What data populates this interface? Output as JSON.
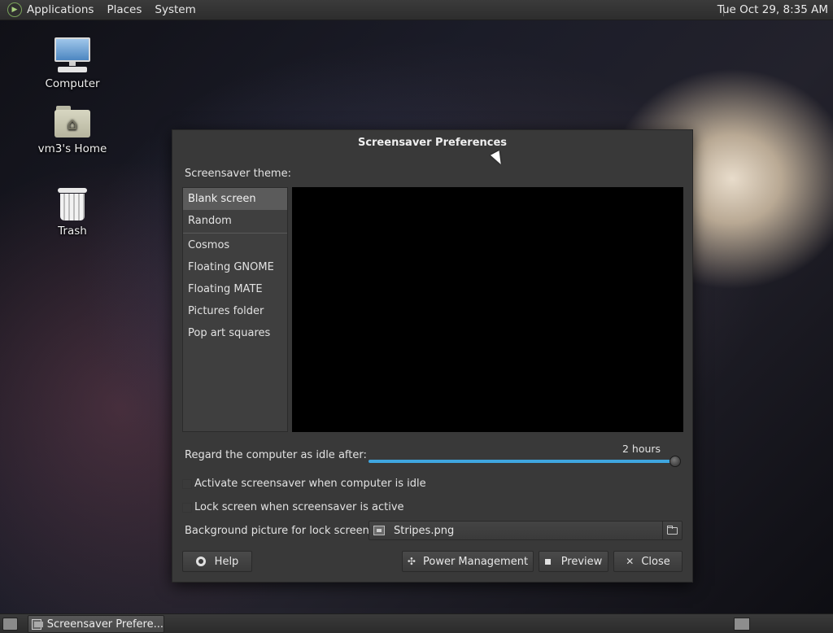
{
  "top_panel": {
    "menus": [
      "Applications",
      "Places",
      "System"
    ],
    "clock": "Tue Oct 29,  8:35 AM"
  },
  "desktop_icons": [
    {
      "label": "Computer",
      "icon": "computer-icon"
    },
    {
      "label": "vm3's Home",
      "icon": "home-folder-icon"
    },
    {
      "label": "Trash",
      "icon": "trash-icon"
    }
  ],
  "dialog": {
    "title": "Screensaver Preferences",
    "theme_label": "Screensaver theme:",
    "themes_top": [
      "Blank screen",
      "Random"
    ],
    "themes": [
      "Cosmos",
      "Floating GNOME",
      "Floating MATE",
      "Pictures folder",
      "Pop art squares"
    ],
    "selected_theme": "Blank screen",
    "idle_label": "Regard the computer as idle after:",
    "idle_value": "2 hours",
    "idle_slider_fraction": 1.0,
    "activate_label": "Activate screensaver when computer is idle",
    "activate_checked": false,
    "lock_label": "Lock screen when screensaver is active",
    "lock_checked": false,
    "bg_label": "Background picture for lock screen:",
    "bg_file": "Stripes.png",
    "buttons": {
      "help": "Help",
      "power": "Power Management",
      "preview": "Preview",
      "close": "Close"
    }
  },
  "bottom_panel": {
    "task_title": "Screensaver Prefere..."
  },
  "colors": {
    "accent": "#3fa6e0",
    "dialog_bg": "#393939",
    "selection": "#5b5b5b"
  }
}
